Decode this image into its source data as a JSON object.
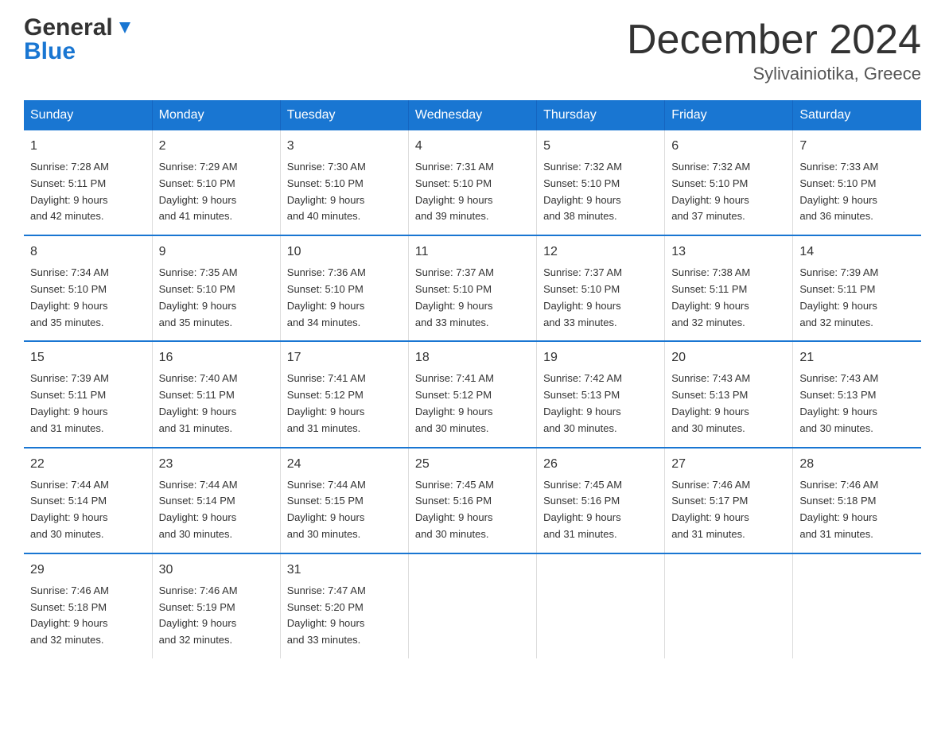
{
  "logo": {
    "general": "General",
    "blue": "Blue"
  },
  "title": {
    "month": "December 2024",
    "location": "Sylivainiotika, Greece"
  },
  "headers": [
    "Sunday",
    "Monday",
    "Tuesday",
    "Wednesday",
    "Thursday",
    "Friday",
    "Saturday"
  ],
  "weeks": [
    [
      {
        "day": "1",
        "sunrise": "7:28 AM",
        "sunset": "5:11 PM",
        "daylight": "9 hours and 42 minutes."
      },
      {
        "day": "2",
        "sunrise": "7:29 AM",
        "sunset": "5:10 PM",
        "daylight": "9 hours and 41 minutes."
      },
      {
        "day": "3",
        "sunrise": "7:30 AM",
        "sunset": "5:10 PM",
        "daylight": "9 hours and 40 minutes."
      },
      {
        "day": "4",
        "sunrise": "7:31 AM",
        "sunset": "5:10 PM",
        "daylight": "9 hours and 39 minutes."
      },
      {
        "day": "5",
        "sunrise": "7:32 AM",
        "sunset": "5:10 PM",
        "daylight": "9 hours and 38 minutes."
      },
      {
        "day": "6",
        "sunrise": "7:32 AM",
        "sunset": "5:10 PM",
        "daylight": "9 hours and 37 minutes."
      },
      {
        "day": "7",
        "sunrise": "7:33 AM",
        "sunset": "5:10 PM",
        "daylight": "9 hours and 36 minutes."
      }
    ],
    [
      {
        "day": "8",
        "sunrise": "7:34 AM",
        "sunset": "5:10 PM",
        "daylight": "9 hours and 35 minutes."
      },
      {
        "day": "9",
        "sunrise": "7:35 AM",
        "sunset": "5:10 PM",
        "daylight": "9 hours and 35 minutes."
      },
      {
        "day": "10",
        "sunrise": "7:36 AM",
        "sunset": "5:10 PM",
        "daylight": "9 hours and 34 minutes."
      },
      {
        "day": "11",
        "sunrise": "7:37 AM",
        "sunset": "5:10 PM",
        "daylight": "9 hours and 33 minutes."
      },
      {
        "day": "12",
        "sunrise": "7:37 AM",
        "sunset": "5:10 PM",
        "daylight": "9 hours and 33 minutes."
      },
      {
        "day": "13",
        "sunrise": "7:38 AM",
        "sunset": "5:11 PM",
        "daylight": "9 hours and 32 minutes."
      },
      {
        "day": "14",
        "sunrise": "7:39 AM",
        "sunset": "5:11 PM",
        "daylight": "9 hours and 32 minutes."
      }
    ],
    [
      {
        "day": "15",
        "sunrise": "7:39 AM",
        "sunset": "5:11 PM",
        "daylight": "9 hours and 31 minutes."
      },
      {
        "day": "16",
        "sunrise": "7:40 AM",
        "sunset": "5:11 PM",
        "daylight": "9 hours and 31 minutes."
      },
      {
        "day": "17",
        "sunrise": "7:41 AM",
        "sunset": "5:12 PM",
        "daylight": "9 hours and 31 minutes."
      },
      {
        "day": "18",
        "sunrise": "7:41 AM",
        "sunset": "5:12 PM",
        "daylight": "9 hours and 30 minutes."
      },
      {
        "day": "19",
        "sunrise": "7:42 AM",
        "sunset": "5:13 PM",
        "daylight": "9 hours and 30 minutes."
      },
      {
        "day": "20",
        "sunrise": "7:43 AM",
        "sunset": "5:13 PM",
        "daylight": "9 hours and 30 minutes."
      },
      {
        "day": "21",
        "sunrise": "7:43 AM",
        "sunset": "5:13 PM",
        "daylight": "9 hours and 30 minutes."
      }
    ],
    [
      {
        "day": "22",
        "sunrise": "7:44 AM",
        "sunset": "5:14 PM",
        "daylight": "9 hours and 30 minutes."
      },
      {
        "day": "23",
        "sunrise": "7:44 AM",
        "sunset": "5:14 PM",
        "daylight": "9 hours and 30 minutes."
      },
      {
        "day": "24",
        "sunrise": "7:44 AM",
        "sunset": "5:15 PM",
        "daylight": "9 hours and 30 minutes."
      },
      {
        "day": "25",
        "sunrise": "7:45 AM",
        "sunset": "5:16 PM",
        "daylight": "9 hours and 30 minutes."
      },
      {
        "day": "26",
        "sunrise": "7:45 AM",
        "sunset": "5:16 PM",
        "daylight": "9 hours and 31 minutes."
      },
      {
        "day": "27",
        "sunrise": "7:46 AM",
        "sunset": "5:17 PM",
        "daylight": "9 hours and 31 minutes."
      },
      {
        "day": "28",
        "sunrise": "7:46 AM",
        "sunset": "5:18 PM",
        "daylight": "9 hours and 31 minutes."
      }
    ],
    [
      {
        "day": "29",
        "sunrise": "7:46 AM",
        "sunset": "5:18 PM",
        "daylight": "9 hours and 32 minutes."
      },
      {
        "day": "30",
        "sunrise": "7:46 AM",
        "sunset": "5:19 PM",
        "daylight": "9 hours and 32 minutes."
      },
      {
        "day": "31",
        "sunrise": "7:47 AM",
        "sunset": "5:20 PM",
        "daylight": "9 hours and 33 minutes."
      },
      null,
      null,
      null,
      null
    ]
  ],
  "labels": {
    "sunrise": "Sunrise:",
    "sunset": "Sunset:",
    "daylight": "Daylight:"
  }
}
